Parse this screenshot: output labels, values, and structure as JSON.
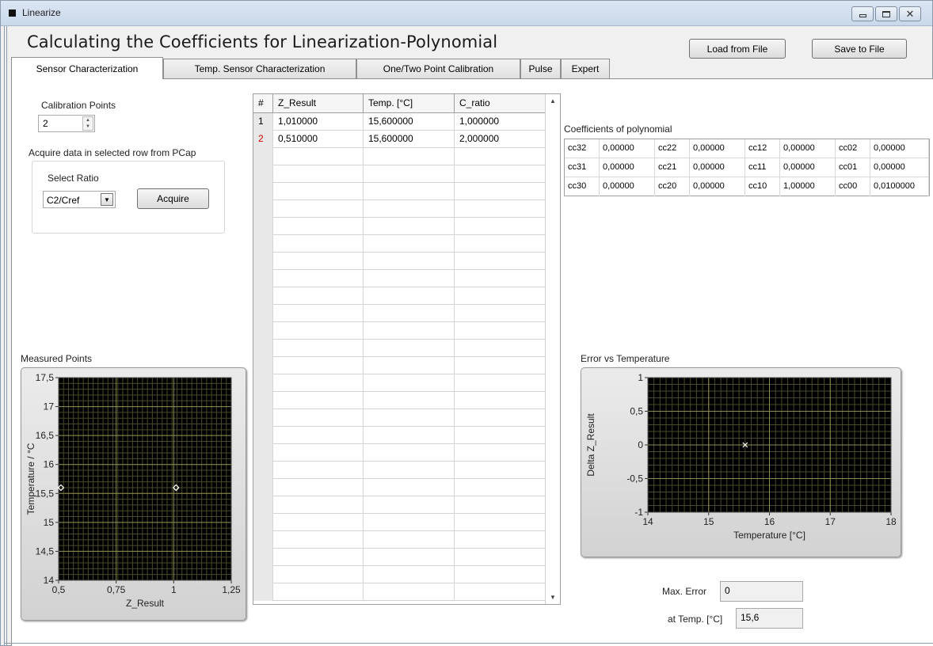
{
  "window": {
    "title": "Linearize"
  },
  "header": {
    "main_title": "Calculating the Coefficients for Linearization-Polynomial",
    "load_button": "Load from File",
    "save_button": "Save to File"
  },
  "tabs": [
    {
      "label": "Sensor Characterization",
      "active": true
    },
    {
      "label": "Temp. Sensor Characterization",
      "active": false
    },
    {
      "label": "One/Two Point Calibration",
      "active": false
    },
    {
      "label": "Pulse",
      "active": false
    },
    {
      "label": "Expert",
      "active": false
    }
  ],
  "calibration": {
    "label": "Calibration Points",
    "value": "2",
    "acquire_caption": "Acquire data in selected row from PCap",
    "ratio_label": "Select Ratio",
    "ratio_value": "C2/Cref",
    "acquire_button": "Acquire"
  },
  "data_table": {
    "headers": [
      "#",
      "Z_Result",
      "Temp. [°C]",
      "C_ratio"
    ],
    "rows": [
      [
        "1",
        "1,010000",
        "15,600000",
        "1,000000"
      ],
      [
        "2",
        "0,510000",
        "15,600000",
        "2,000000"
      ]
    ]
  },
  "coefficients": {
    "title": "Coefficients of polynomial",
    "rows": [
      [
        [
          "cc32",
          "0,00000"
        ],
        [
          "cc22",
          "0,00000"
        ],
        [
          "cc12",
          "0,00000"
        ],
        [
          "cc02",
          "0,00000"
        ]
      ],
      [
        [
          "cc31",
          "0,00000"
        ],
        [
          "cc21",
          "0,00000"
        ],
        [
          "cc11",
          "0,00000"
        ],
        [
          "cc01",
          "0,00000"
        ]
      ],
      [
        [
          "cc30",
          "0,00000"
        ],
        [
          "cc20",
          "0,00000"
        ],
        [
          "cc10",
          "1,00000"
        ],
        [
          "cc00",
          "0,0100000"
        ]
      ]
    ]
  },
  "results": {
    "max_error_label": "Max. Error",
    "max_error_value": "0",
    "at_temp_label": "at Temp. [°C]",
    "at_temp_value": "15,6"
  },
  "chart_data": [
    {
      "type": "scatter",
      "title": "Measured Points",
      "xlabel": "Z_Result",
      "ylabel": "Temperature / °C",
      "xlim": [
        0.5,
        1.25
      ],
      "ylim": [
        14,
        17.5
      ],
      "xticks": [
        0.5,
        0.75,
        1,
        1.25
      ],
      "xtick_labels": [
        "0,5",
        "0,75",
        "1",
        "1,25"
      ],
      "yticks": [
        14,
        14.5,
        15,
        15.5,
        16,
        16.5,
        17,
        17.5
      ],
      "ytick_labels": [
        "14",
        "14,5",
        "15",
        "15,5",
        "16",
        "16,5",
        "17",
        "17,5"
      ],
      "grid": true,
      "marker": "diamond",
      "points": [
        {
          "x": 0.51,
          "y": 15.6
        },
        {
          "x": 1.01,
          "y": 15.6
        }
      ]
    },
    {
      "type": "scatter",
      "title": "Error vs Temperature",
      "xlabel": "Temperature [°C]",
      "ylabel": "Delta Z_Result",
      "xlim": [
        14,
        18
      ],
      "ylim": [
        -1,
        1
      ],
      "xticks": [
        14,
        15,
        16,
        17,
        18
      ],
      "xtick_labels": [
        "14",
        "15",
        "16",
        "17",
        "18"
      ],
      "yticks": [
        -1,
        -0.5,
        0,
        0.5,
        1
      ],
      "ytick_labels": [
        "-1",
        "-0,5",
        "0",
        "0,5",
        "1"
      ],
      "grid": true,
      "marker": "cross",
      "points": [
        {
          "x": 15.6,
          "y": 0
        }
      ]
    }
  ]
}
